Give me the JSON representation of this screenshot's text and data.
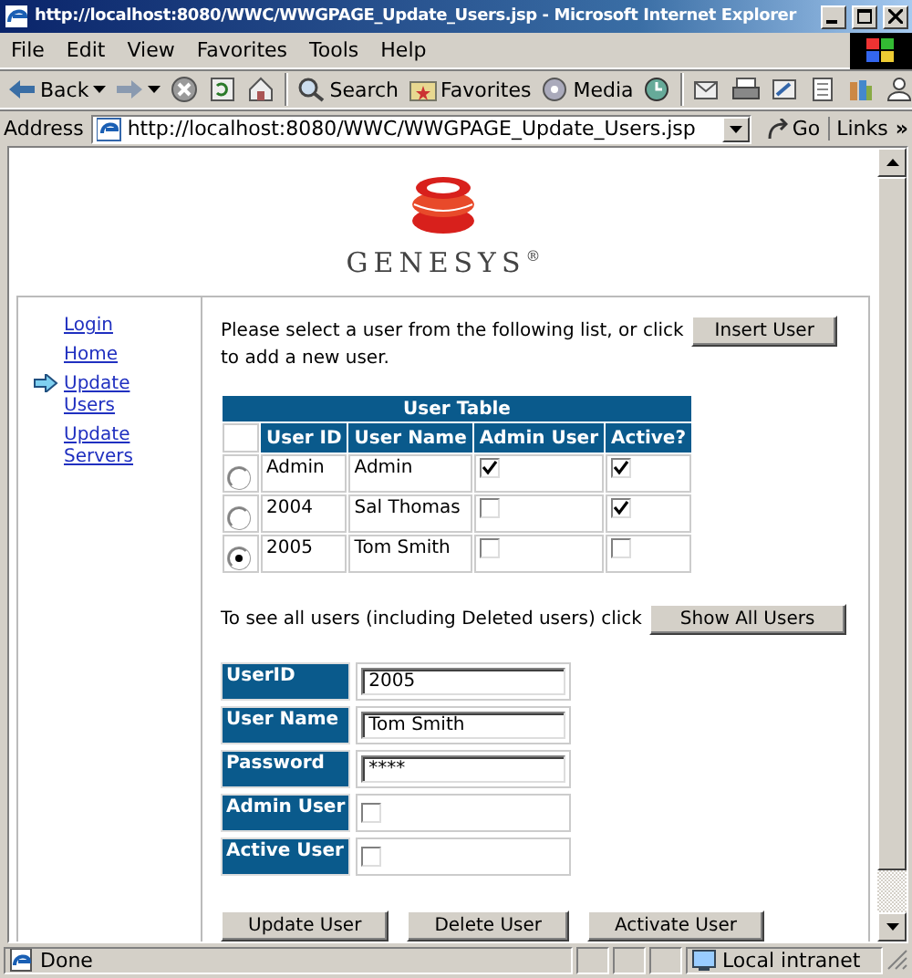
{
  "window": {
    "title": "http://localhost:8080/WWC/WWGPAGE_Update_Users.jsp - Microsoft Internet Explorer"
  },
  "menu": [
    "File",
    "Edit",
    "View",
    "Favorites",
    "Tools",
    "Help"
  ],
  "toolbar": [
    {
      "kind": "back",
      "label": "Back"
    },
    {
      "kind": "forward"
    },
    {
      "kind": "stop"
    },
    {
      "kind": "refresh"
    },
    {
      "kind": "home"
    },
    {
      "kind": "sep"
    },
    {
      "kind": "search",
      "label": "Search"
    },
    {
      "kind": "favorites",
      "label": "Favorites"
    },
    {
      "kind": "media",
      "label": "Media"
    },
    {
      "kind": "history"
    },
    {
      "kind": "sep"
    },
    {
      "kind": "mail"
    },
    {
      "kind": "print"
    },
    {
      "kind": "edit"
    },
    {
      "kind": "discuss"
    },
    {
      "kind": "research"
    },
    {
      "kind": "messenger"
    }
  ],
  "address_bar": {
    "label": "Address",
    "url": "http://localhost:8080/WWC/WWGPAGE_Update_Users.jsp",
    "go": "Go",
    "links": "Links",
    "more": "»"
  },
  "logo": {
    "text": "GENESYS$^{®}$"
  },
  "nav": [
    {
      "label": "Login",
      "selected": false
    },
    {
      "label": "Home",
      "selected": false
    },
    {
      "label": "Update Users",
      "selected": true
    },
    {
      "label": "Update Servers",
      "selected": false
    }
  ],
  "intro": {
    "before": "Please select a user from the following list, or click",
    "button": "Insert User",
    "after": "to add a new user."
  },
  "table": {
    "caption": "User Table",
    "columns": [
      "User ID",
      "User Name",
      "Admin User",
      "Active?"
    ],
    "rows": [
      {
        "selected": false,
        "user_id": "Admin",
        "user_name": "Admin",
        "admin": true,
        "active": true
      },
      {
        "selected": false,
        "user_id": "2004",
        "user_name": "Sal Thomas",
        "admin": false,
        "active": true
      },
      {
        "selected": true,
        "user_id": "2005",
        "user_name": "Tom Smith",
        "admin": false,
        "active": false
      }
    ]
  },
  "show_all": {
    "text": "To see all users (including Deleted users) click",
    "button": "Show All Users"
  },
  "form": [
    {
      "kind": "text",
      "label": "UserID",
      "value": "2005"
    },
    {
      "kind": "text",
      "label": "User Name",
      "value": "Tom Smith"
    },
    {
      "kind": "text",
      "label": "Password",
      "value": "****"
    },
    {
      "kind": "checkbox",
      "label": "Admin User",
      "checked": false
    },
    {
      "kind": "checkbox",
      "label": "Active User",
      "checked": false
    }
  ],
  "buttons": [
    "Update User",
    "Delete User",
    "Activate User"
  ],
  "status_bar": {
    "text": "Done",
    "zone": "Local intranet"
  }
}
